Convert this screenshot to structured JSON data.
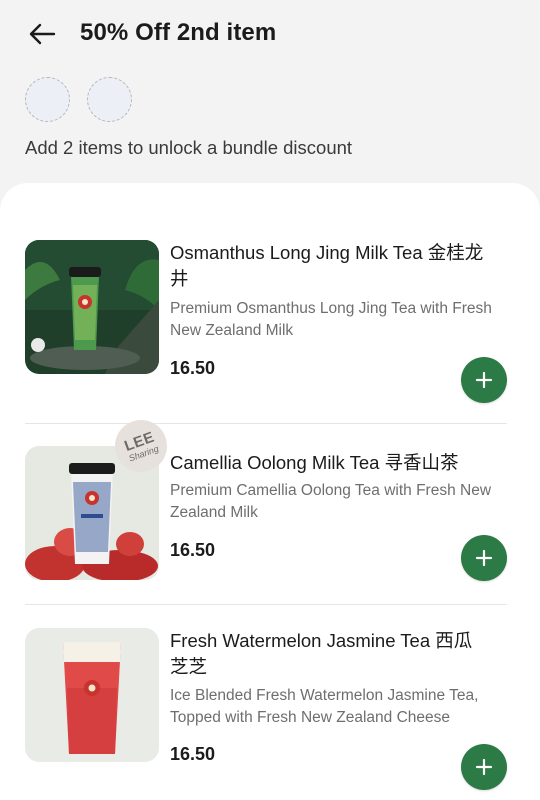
{
  "header": {
    "title": "50% Off 2nd item"
  },
  "bundle": {
    "slot_count": 2,
    "message": "Add 2 items to unlock a bundle discount"
  },
  "items": [
    {
      "name": "Osmanthus Long Jing Milk Tea 金桂龙井",
      "description": "Premium Osmanthus Long Jing Tea with Fresh New Zealand Milk",
      "price": "16.50",
      "image": "osmanthus-cup-image"
    },
    {
      "name": "Camellia Oolong Milk Tea 寻香山茶",
      "description": "Premium Camellia Oolong Tea with Fresh New Zealand Milk",
      "price": "16.50",
      "image": "camellia-cup-image",
      "badge": {
        "line1": "LEE",
        "line2": "Sharing"
      }
    },
    {
      "name": "Fresh Watermelon Jasmine Tea 西瓜芝芝",
      "description": "Ice Blended Fresh Watermelon Jasmine Tea, Topped with Fresh New Zealand Cheese",
      "price": "16.50",
      "image": "watermelon-cup-image"
    }
  ],
  "colors": {
    "accent": "#2c7a45",
    "background": "#f3f3f3",
    "sheet": "#ffffff"
  },
  "icons": {
    "back": "arrow-left-icon",
    "add": "plus-icon"
  }
}
